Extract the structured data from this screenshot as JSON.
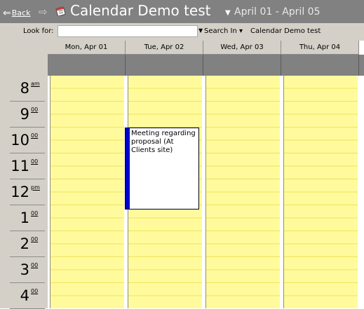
{
  "header": {
    "back_label": "Back",
    "back_arrow": "⇐",
    "forward_arrow": "⇨",
    "title": "Calendar Demo test",
    "title_caret": "▼",
    "date_range": "April 01 - April 05",
    "icons": [
      "back-arrow-icon",
      "forward-arrow-icon",
      "calendar-icon"
    ]
  },
  "toolbar": {
    "look_for_label": "Look for:",
    "look_for_value": "",
    "search_in_label": "Search In ▾",
    "search_in_value": "Calendar Demo test",
    "dropdown_arrow": "▼"
  },
  "days": [
    "Mon, Apr 01",
    "Tue, Apr 02",
    "Wed, Apr 03",
    "Thu, Apr 04"
  ],
  "time_slots": [
    {
      "hour": "8",
      "minutes": "am"
    },
    {
      "hour": "9",
      "minutes": "00"
    },
    {
      "hour": "10",
      "minutes": "00"
    },
    {
      "hour": "11",
      "minutes": "00"
    },
    {
      "hour": "12",
      "minutes": "pm"
    },
    {
      "hour": "1",
      "minutes": "00"
    },
    {
      "hour": "2",
      "minutes": "00"
    },
    {
      "hour": "3",
      "minutes": "00"
    },
    {
      "hour": "4",
      "minutes": "00"
    }
  ],
  "appointments": [
    {
      "day": "Tue, Apr 02",
      "start": "10:00",
      "end": "1:00",
      "text": "Meeting regarding proposal (At Clients site)",
      "status_color": "#0000cc"
    }
  ],
  "colors": {
    "header_bg": "#818181",
    "working_hours": "#fffb9d",
    "toolbar_bg": "#d4d0c8",
    "appointment_status": "#0000cc"
  }
}
